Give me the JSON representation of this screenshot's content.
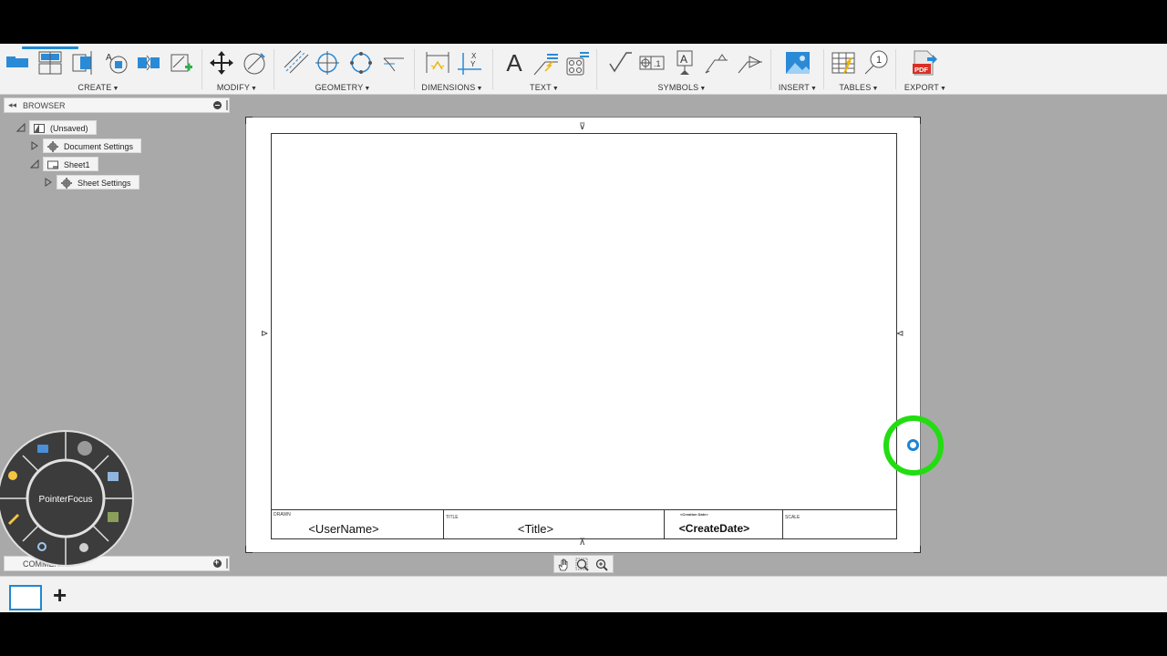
{
  "toolbar": {
    "groups": [
      {
        "label": "CREATE"
      },
      {
        "label": "MODIFY"
      },
      {
        "label": "GEOMETRY"
      },
      {
        "label": "DIMENSIONS"
      },
      {
        "label": "TEXT"
      },
      {
        "label": "SYMBOLS"
      },
      {
        "label": "INSERT"
      },
      {
        "label": "TABLES"
      },
      {
        "label": "EXPORT"
      }
    ],
    "pdf_badge": "PDF",
    "text_glyph": "A",
    "symbol_text_glyph": "A",
    "table_balloon": "1",
    "accent_color": "#1e88d4"
  },
  "browser": {
    "title": "BROWSER",
    "tree": [
      {
        "label": "(Unsaved)"
      },
      {
        "label": "Document Settings"
      },
      {
        "label": "Sheet1"
      },
      {
        "label": "Sheet Settings"
      }
    ]
  },
  "comments": {
    "title": "COMMENTS"
  },
  "drawing": {
    "title_block": {
      "drawn_label": "DRAWN",
      "drawn_value": "<UserName>",
      "title_label": "TITLE",
      "title_value": "<Title>",
      "date_label": "<Creation Date>",
      "date_value": "<CreateDate>",
      "scale_label": "SCALE"
    }
  },
  "marking_menu": {
    "center_label": "PointerFocus",
    "pointer_ring_color": "#22dd11"
  }
}
